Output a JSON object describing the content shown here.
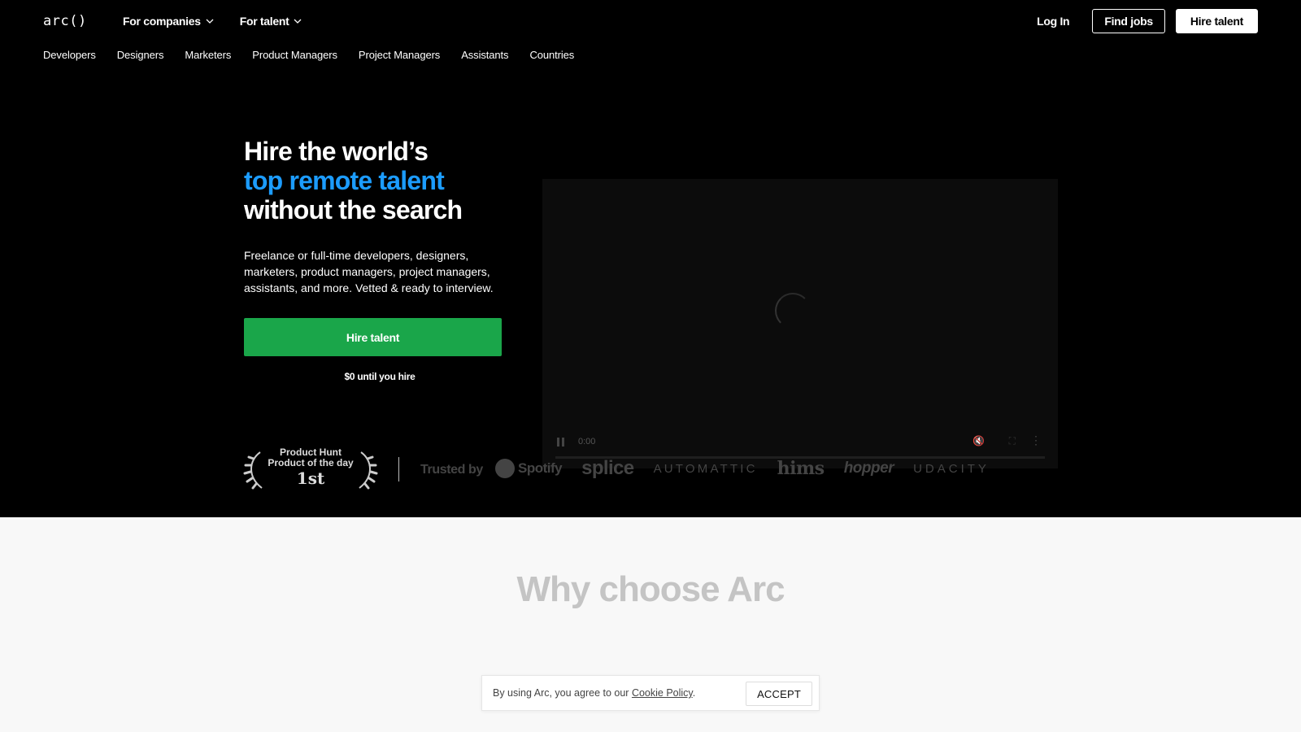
{
  "header": {
    "logo": "arc()",
    "dropdowns": [
      {
        "label": "For companies"
      },
      {
        "label": "For talent"
      }
    ],
    "login": "Log In",
    "find_jobs": "Find jobs",
    "hire_talent": "Hire talent"
  },
  "subnav": [
    "Developers",
    "Designers",
    "Marketers",
    "Product Managers",
    "Project Managers",
    "Assistants",
    "Countries"
  ],
  "hero": {
    "headline_1": "Hire the world’s",
    "headline_2": "top remote talent",
    "headline_3": "without the search",
    "subtext": "Freelance or full-time developers, designers, marketers, product managers, project managers, assistants, and more. Vetted & ready to interview.",
    "cta": "Hire talent",
    "free_note": "$0 until you hire"
  },
  "video": {
    "time": "0:00"
  },
  "award": {
    "line1": "Product Hunt",
    "line2": "Product of the day",
    "rank": "1st"
  },
  "trusted": {
    "label": "Trusted by",
    "brands": [
      "Spotify",
      "splice",
      "AUTOMATTIC",
      "hims",
      "hopper",
      "UDACITY"
    ]
  },
  "why": {
    "title": "Why choose Arc"
  },
  "cookie": {
    "message": "By using Arc, you agree to our ",
    "link": "Cookie Policy",
    "suffix": ".",
    "accept": "ACCEPT"
  },
  "colors": {
    "hero_bg": "#000000",
    "accent_blue": "#1c9cff",
    "cta_green": "#1aa64a",
    "page_bg": "#f8f8f8"
  }
}
